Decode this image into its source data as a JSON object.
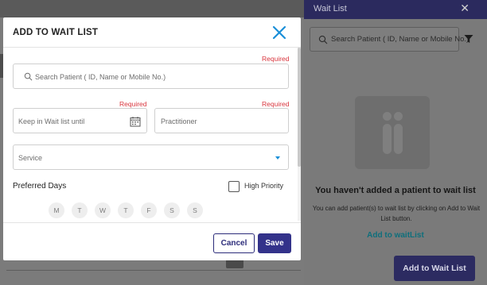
{
  "modal": {
    "title": "ADD TO WAIT LIST",
    "required_text": "Required",
    "search_placeholder": "Search Patient ( ID, Name or Mobile No.)",
    "wait_until_placeholder": "Keep in Wait list until",
    "practitioner_placeholder": "Practitioner",
    "service_placeholder": "Service",
    "preferred_days_label": "Preferred Days",
    "high_priority_label": "High Priority",
    "days": [
      "M",
      "T",
      "W",
      "T",
      "F",
      "S",
      "S"
    ],
    "cancel_label": "Cancel",
    "save_label": "Save",
    "accent_color": "#33328a",
    "close_color": "#1a8fd8"
  },
  "panel": {
    "title": "Wait List",
    "search_placeholder": "Search Patient ( ID, Name or Mobile No.)",
    "empty_title": "You haven't added a patient to wait list",
    "empty_description": "You can add patient(s) to wait list by clicking on Add to Wait List button.",
    "add_link": "Add to waitList",
    "add_button": "Add to Wait List"
  },
  "icons": {
    "modal_close": "close-icon",
    "search": "search-icon",
    "calendar": "calendar-icon",
    "dropdown": "chevron-down-icon",
    "filter": "filter-icon",
    "panel_close": "close-icon"
  }
}
